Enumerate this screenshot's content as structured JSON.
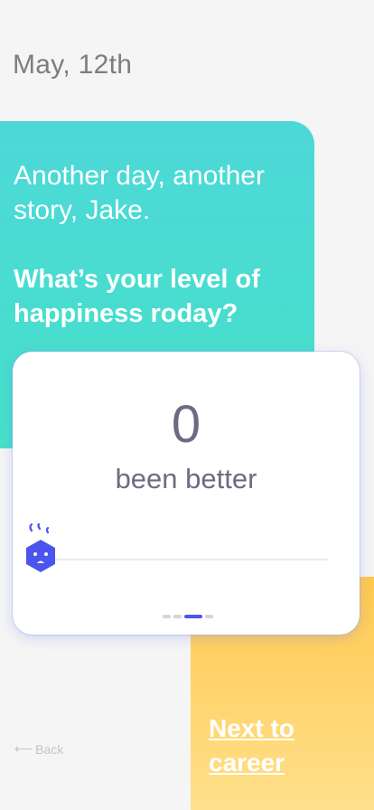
{
  "header": {
    "date": "May, 12th"
  },
  "prompt": {
    "greeting": "Another day, another story, Jake.",
    "question": "What’s your level of happiness roday?"
  },
  "mood_card": {
    "score": "0",
    "label": "been better",
    "slider": {
      "value": 0,
      "min": 0,
      "max": 10,
      "thumb_icon": "sad-hexagon-face-icon"
    },
    "pager": {
      "count": 4,
      "active_index": 2
    }
  },
  "nav": {
    "back_label": "Back",
    "next_label": "Next to career"
  },
  "colors": {
    "teal": "#4dd8d8",
    "yellow": "#ffc94f",
    "accent": "#4a55f0",
    "text_muted": "#6d6b84"
  }
}
